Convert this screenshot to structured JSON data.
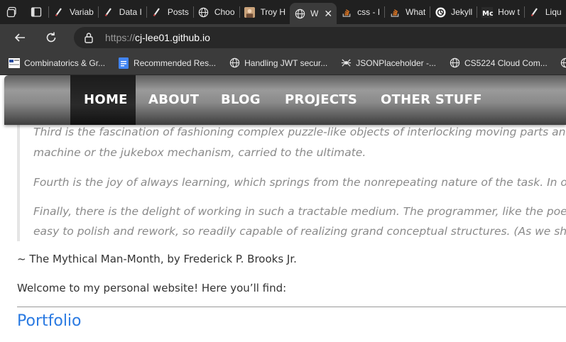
{
  "tabs": [
    {
      "title": "Variab",
      "icon": "pen-icon"
    },
    {
      "title": "Data I",
      "icon": "pen-icon"
    },
    {
      "title": "Posts",
      "icon": "pen-icon"
    },
    {
      "title": "Choo",
      "icon": "globe-icon"
    },
    {
      "title": "Troy H",
      "icon": "avatar-icon"
    },
    {
      "title": "W",
      "icon": "globe-icon",
      "active": true
    },
    {
      "title": "css - I",
      "icon": "stack-icon"
    },
    {
      "title": "What",
      "icon": "stack-icon"
    },
    {
      "title": "Jekyll",
      "icon": "openai-icon"
    },
    {
      "title": "How t",
      "icon": "m-logo-icon"
    },
    {
      "title": "Liqu",
      "icon": "pen-icon"
    }
  ],
  "address": {
    "scheme": "https://",
    "host": "cj-lee01.github.io"
  },
  "bookmarks": [
    {
      "label": "Combinatorics & Gr...",
      "icon": "site-icon"
    },
    {
      "label": "Recommended Res...",
      "icon": "docs-icon"
    },
    {
      "label": "Handling JWT secur...",
      "icon": "globe-icon"
    },
    {
      "label": "JSONPlaceholder -...",
      "icon": "spider-icon"
    },
    {
      "label": "CS5224 Cloud Com...",
      "icon": "globe-icon"
    }
  ],
  "site_nav": {
    "home": "HOME",
    "about": "ABOUT",
    "blog": "BLOG",
    "projects": "PROJECTS",
    "other": "OTHER STUFF"
  },
  "quote": {
    "p1_line1": "Third is the fascination of fashioning complex puzzle-like objects of interlocking moving parts and watching them",
    "p1_line2": "machine or the jukebox mechanism, carried to the ultimate.",
    "p2": "Fourth is the joy of always learning, which springs from the nonrepeating nature of the task. In one way or anoth",
    "p3_line1": "Finally, there is the delight of working in such a tractable medium. The programmer, like the poet, works only slig",
    "p3_line2": "easy to polish and rework, so readily capable of realizing grand conceptual structures. (As we shall see later, this v"
  },
  "attribution": "~ The Mythical Man-Month, by Frederick P. Brooks Jr.",
  "welcome": "Welcome to my personal website! Here you’ll find:",
  "portfolio_heading": "Portfolio"
}
